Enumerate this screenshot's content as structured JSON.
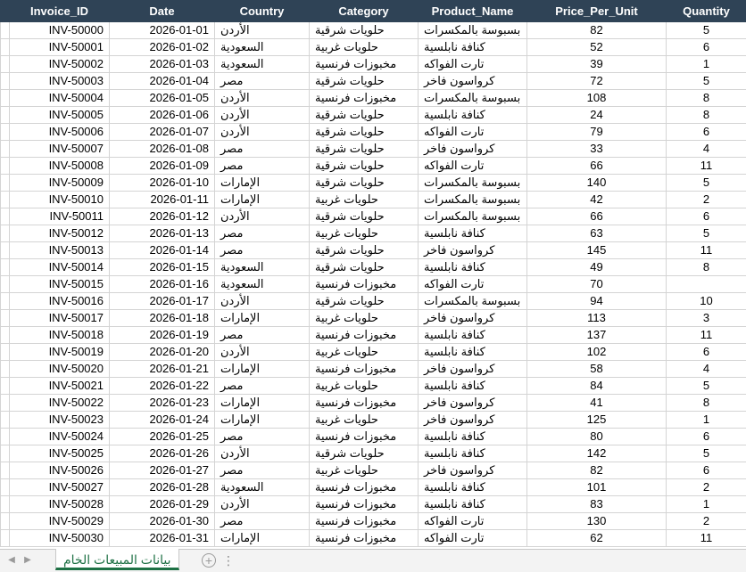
{
  "table": {
    "headers": [
      "Invoice_ID",
      "Date",
      "Country",
      "Category",
      "Product_Name",
      "Price_Per_Unit",
      "Quantity"
    ],
    "rows": [
      [
        "INV-50000",
        "2026-01-01",
        "الأردن",
        "حلويات شرقية",
        "بسبوسة بالمكسرات",
        "82",
        "5"
      ],
      [
        "INV-50001",
        "2026-01-02",
        "السعودية",
        "حلويات غربية",
        "كنافة نابلسية",
        "52",
        "6"
      ],
      [
        "INV-50002",
        "2026-01-03",
        "السعودية",
        "مخبوزات فرنسية",
        "تارت الفواكه",
        "39",
        "1"
      ],
      [
        "INV-50003",
        "2026-01-04",
        "مصر",
        "حلويات شرقية",
        "كرواسون فاخر",
        "72",
        "5"
      ],
      [
        "INV-50004",
        "2026-01-05",
        "الأردن",
        "مخبوزات فرنسية",
        "بسبوسة بالمكسرات",
        "108",
        "8"
      ],
      [
        "INV-50005",
        "2026-01-06",
        "الأردن",
        "حلويات شرقية",
        "كنافة نابلسية",
        "24",
        "8"
      ],
      [
        "INV-50006",
        "2026-01-07",
        "الأردن",
        "حلويات شرقية",
        "تارت الفواكه",
        "79",
        "6"
      ],
      [
        "INV-50007",
        "2026-01-08",
        "مصر",
        "حلويات شرقية",
        "كرواسون فاخر",
        "33",
        "4"
      ],
      [
        "INV-50008",
        "2026-01-09",
        "مصر",
        "حلويات شرقية",
        "تارت الفواكه",
        "66",
        "11"
      ],
      [
        "INV-50009",
        "2026-01-10",
        "الإمارات",
        "حلويات شرقية",
        "بسبوسة بالمكسرات",
        "140",
        "5"
      ],
      [
        "INV-50010",
        "2026-01-11",
        "الإمارات",
        "حلويات غربية",
        "بسبوسة بالمكسرات",
        "42",
        "2"
      ],
      [
        "INV-50011",
        "2026-01-12",
        "الأردن",
        "حلويات شرقية",
        "بسبوسة بالمكسرات",
        "66",
        "6"
      ],
      [
        "INV-50012",
        "2026-01-13",
        "مصر",
        "حلويات غربية",
        "كنافة نابلسية",
        "63",
        "5"
      ],
      [
        "INV-50013",
        "2026-01-14",
        "مصر",
        "حلويات شرقية",
        "كرواسون فاخر",
        "145",
        "11"
      ],
      [
        "INV-50014",
        "2026-01-15",
        "السعودية",
        "حلويات شرقية",
        "كنافة نابلسية",
        "49",
        "8"
      ],
      [
        "INV-50015",
        "2026-01-16",
        "السعودية",
        "مخبوزات فرنسية",
        "تارت الفواكه",
        "70",
        ""
      ],
      [
        "INV-50016",
        "2026-01-17",
        "الأردن",
        "حلويات شرقية",
        "بسبوسة بالمكسرات",
        "94",
        "10"
      ],
      [
        "INV-50017",
        "2026-01-18",
        "الإمارات",
        "حلويات غربية",
        "كرواسون فاخر",
        "113",
        "3"
      ],
      [
        "INV-50018",
        "2026-01-19",
        "مصر",
        "مخبوزات فرنسية",
        "كنافة نابلسية",
        "137",
        "11"
      ],
      [
        "INV-50019",
        "2026-01-20",
        "الأردن",
        "حلويات غربية",
        "كنافة نابلسية",
        "102",
        "6"
      ],
      [
        "INV-50020",
        "2026-01-21",
        "الإمارات",
        "مخبوزات فرنسية",
        "كرواسون فاخر",
        "58",
        "4"
      ],
      [
        "INV-50021",
        "2026-01-22",
        "مصر",
        "حلويات غربية",
        "كنافة نابلسية",
        "84",
        "5"
      ],
      [
        "INV-50022",
        "2026-01-23",
        "الإمارات",
        "مخبوزات فرنسية",
        "كرواسون فاخر",
        "41",
        "8"
      ],
      [
        "INV-50023",
        "2026-01-24",
        "الإمارات",
        "حلويات غربية",
        "كرواسون فاخر",
        "125",
        "1"
      ],
      [
        "INV-50024",
        "2026-01-25",
        "مصر",
        "مخبوزات فرنسية",
        "كنافة نابلسية",
        "80",
        "6"
      ],
      [
        "INV-50025",
        "2026-01-26",
        "الأردن",
        "حلويات شرقية",
        "كنافة نابلسية",
        "142",
        "5"
      ],
      [
        "INV-50026",
        "2026-01-27",
        "مصر",
        "حلويات غربية",
        "كرواسون فاخر",
        "82",
        "6"
      ],
      [
        "INV-50027",
        "2026-01-28",
        "السعودية",
        "مخبوزات فرنسية",
        "كنافة نابلسية",
        "101",
        "2"
      ],
      [
        "INV-50028",
        "2026-01-29",
        "الأردن",
        "مخبوزات فرنسية",
        "كنافة نابلسية",
        "83",
        "1"
      ],
      [
        "INV-50029",
        "2026-01-30",
        "مصر",
        "مخبوزات فرنسية",
        "تارت الفواكه",
        "130",
        "2"
      ],
      [
        "INV-50030",
        "2026-01-31",
        "الإمارات",
        "مخبوزات فرنسية",
        "تارت الفواكه",
        "62",
        "11"
      ]
    ]
  },
  "sheet_tabs": {
    "active_label": "بيانات المبيعات الخام",
    "add_icon": "plus-circle-icon",
    "nav_prev_icon": "triangle-left-icon",
    "nav_next_icon": "triangle-right-icon",
    "more_icon": "ellipsis-icon"
  },
  "colors": {
    "header_bg": "#2f4356",
    "header_text": "#ffffff",
    "active_tab_text": "#1e7145"
  }
}
